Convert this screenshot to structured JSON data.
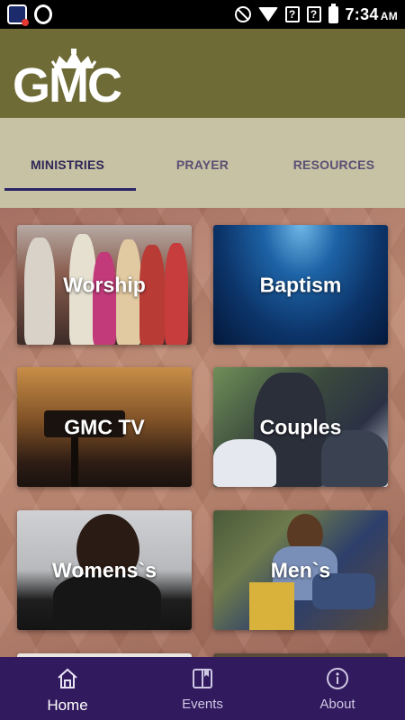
{
  "status_bar": {
    "time": "7:34",
    "ampm": "AM",
    "signal_badge_1": "?",
    "signal_badge_2": "?"
  },
  "header": {
    "logo_text": "GMC"
  },
  "tabs": [
    {
      "label": "MINISTRIES",
      "active": true
    },
    {
      "label": "PRAYER",
      "active": false
    },
    {
      "label": "RESOURCES",
      "active": false
    }
  ],
  "ministries": [
    {
      "label": "Worship"
    },
    {
      "label": "Baptism"
    },
    {
      "label": "GMC TV"
    },
    {
      "label": "Couples"
    },
    {
      "label": "Womens`s"
    },
    {
      "label": "Men`s"
    }
  ],
  "bottom_nav": [
    {
      "label": "Home",
      "icon": "home-icon",
      "active": true
    },
    {
      "label": "Events",
      "icon": "book-icon",
      "active": false
    },
    {
      "label": "About",
      "icon": "info-icon",
      "active": false
    }
  ],
  "colors": {
    "header_bg": "#6e6b36",
    "tabs_bg": "#c6c2a3",
    "tab_active": "#2f2757",
    "nav_bg": "#311a5e"
  }
}
